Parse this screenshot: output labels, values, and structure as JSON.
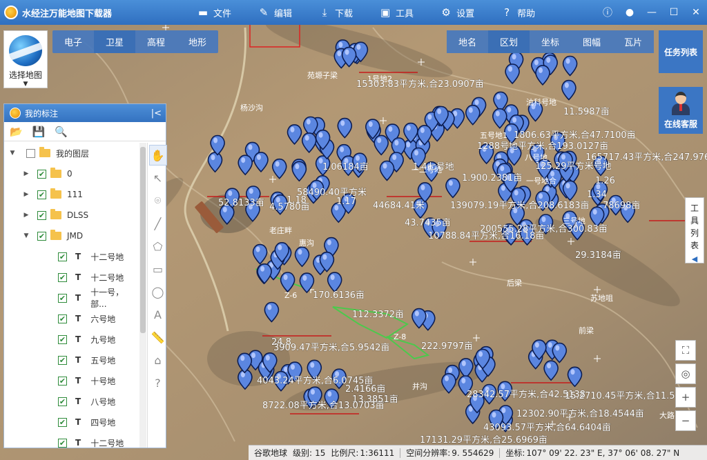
{
  "app": {
    "title": "水经注万能地图下载器"
  },
  "menu": [
    {
      "label": "文件",
      "icon": "folder-icon"
    },
    {
      "label": "编辑",
      "icon": "edit-icon"
    },
    {
      "label": "下载",
      "icon": "download-icon"
    },
    {
      "label": "工具",
      "icon": "toolbox-icon"
    },
    {
      "label": "设置",
      "icon": "gear-icon"
    },
    {
      "label": "帮助",
      "icon": "help-icon"
    }
  ],
  "map_types": [
    "电子",
    "卫星",
    "高程",
    "地形"
  ],
  "map_type_selected": "卫星",
  "logo_label": "选择地图",
  "right_tools": [
    "地名",
    "区划",
    "坐标",
    "图幅",
    "瓦片"
  ],
  "right_tool_selected": "区划",
  "task_list": "任务列表",
  "online_service": "在线客服",
  "tool_list": [
    "工",
    "具",
    "列",
    "表"
  ],
  "panel": {
    "title": "我的标注",
    "root": "我的图层",
    "layers": [
      {
        "label": "0",
        "expanded": false
      },
      {
        "label": "111",
        "expanded": false
      },
      {
        "label": "DLSS",
        "expanded": false
      },
      {
        "label": "JMD",
        "expanded": true
      }
    ],
    "items": [
      "十二号地",
      "十二号地",
      "十一号，部...",
      "六号地",
      "九号地",
      "五号地",
      "十号地",
      "八号地",
      "四号地",
      "十二号地"
    ]
  },
  "status": {
    "source": "谷歌地球",
    "level_label": "级别:",
    "level": "15",
    "scale_label": "比例尺:",
    "scale": "1:36111",
    "res_label": "空间分辨率:",
    "resolution": "9. 554629",
    "coord_label": "坐标:",
    "coord": "107° 09' 22. 23\" E, 37° 06' 08. 27\" N"
  },
  "map_labels": [
    "1号地2",
    "15303.83平方米,合23.0907亩",
    "杨沙沟",
    "油科号地",
    "11.5987亩",
    "五号地1",
    "1806.63平方米,合47.7100亩",
    "1288号地平方米,合193.0127亩",
    "八号地",
    "165717.43平方米,合247.9761",
    "125.29平方米号地",
    "1.06184亩",
    "1.4七号地",
    "1.900.2381亩",
    "一号地合",
    "1.26",
    "52.8133亩",
    "1.18",
    "4.5780亩",
    "58490.40平方米",
    "1.17",
    "44684.41米",
    "一二号地",
    "43.7435亩",
    "139079.19平方米,合208.6183亩",
    "1.34",
    "78698亩",
    "200555.28平方米,合300.83亩",
    "10788.84平方米,合16.18亩",
    "老庄畔",
    "惠沟",
    "29.3184亩",
    "Z-6",
    "170.6136亩",
    "112.3372亩",
    "Z-8",
    "222.9797亩",
    "24.8",
    "3909.47平方米,合5.9542亩",
    "后梁",
    "苏地咀",
    "前梁",
    "4043.24平方米,合6.0745亩",
    "2.4166亩",
    "13.3851亩",
    "8722.08平方米,合13.0703亩",
    "28342.57平方米,合42.5138",
    "15.2710.45平方米,合11.5",
    "12302.90平方米,合18.4544亩",
    "43093.57平方米,合64.6404亩",
    "17131.29平方米,合25.6969亩",
    "并沟",
    "苑塬子梁",
    "三号地",
    "大路"
  ]
}
